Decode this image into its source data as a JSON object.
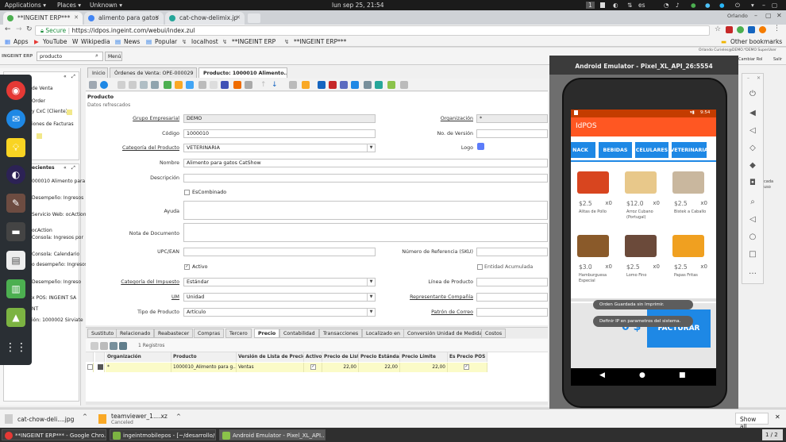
{
  "os_topbar": {
    "applications": "Applications ▾",
    "places": "Places ▾",
    "unknown": "Unknown ▾",
    "datetime": "lun sep 25, 21:54",
    "workspace": "1",
    "lang": "es"
  },
  "browser": {
    "tabs": [
      {
        "label": "**INGEINT ERP***",
        "color": "#4caf50"
      },
      {
        "label": "alimento para gatos",
        "color": "#4285f4"
      },
      {
        "label": "cat-chow-delimix.jp",
        "color": "#26a69a"
      }
    ],
    "profile": "Orlando",
    "secure_label": "Secure",
    "url": "https://idpos.ingeint.com/webui/index.zul",
    "bookmarks": [
      "Apps",
      "YouTube",
      "Wikipedia",
      "News",
      "Popular",
      "localhost",
      "**INGEINT ERP",
      "**INGEINT ERP***"
    ],
    "other_bookmarks": "Other bookmarks"
  },
  "erp": {
    "logo": "INGEINT ERP",
    "search_value": "producto",
    "menu_label": "Menú",
    "user_line": "Orlando Curieles@DEMO.*DEMO SuperUser",
    "user_links": [
      "Cambiar Rol",
      "Salir"
    ],
    "left_panel": {
      "box1": [
        "de Venta",
        "Order",
        "y CxC (Cliente)",
        "iones de Facturas"
      ],
      "recent_header": "ecientes",
      "recent": [
        "000010 Alimento para",
        "Desempeño: Ingresos",
        "Servicio Web: ocAction",
        "ocAction",
        "Consola: Ingresos por",
        "Consola: Calendario",
        "o desempeño: Ingresos",
        "Desempeño: Ingreso",
        "x POS: INGEINT SA",
        "NT",
        "ión: 1000002 Sirviate"
      ]
    },
    "main_tabs": [
      "Inicio",
      "Órdenes de Venta: OPE-000029",
      "Producto: 1000010 Alimento..."
    ],
    "form_title": "Producto",
    "form_status": "Datos refrescados",
    "fields": {
      "grupo_empresarial": {
        "label": "Grupo Empresarial",
        "value": "DEMO"
      },
      "organizacion": {
        "label": "Organización",
        "value": "*"
      },
      "codigo": {
        "label": "Código",
        "value": "1000010"
      },
      "no_version": {
        "label": "No. de Versión",
        "value": ""
      },
      "categoria_producto": {
        "label": "Categoría del Producto",
        "value": "VETERINARIA"
      },
      "logo": {
        "label": "Logo"
      },
      "nombre": {
        "label": "Nombre",
        "value": "Alimento para gatos CatShow"
      },
      "descripcion": {
        "label": "Descripción",
        "value": ""
      },
      "escombinado": {
        "label": "EsCombinado"
      },
      "ayuda": {
        "label": "Ayuda",
        "value": ""
      },
      "nota_documento": {
        "label": "Nota de Documento",
        "value": ""
      },
      "upc": {
        "label": "UPC/EAN",
        "value": ""
      },
      "no_referencia": {
        "label": "Número de Referencia (SKU)",
        "value": ""
      },
      "activo": {
        "label": "Activo"
      },
      "entidad_acumulada": {
        "label": "Entidad Acumulada"
      },
      "categoria_impuesto": {
        "label": "Categoría del Impuesto",
        "value": "Estándar"
      },
      "linea_producto": {
        "label": "Línea de Producto",
        "value": ""
      },
      "um": {
        "label": "UM",
        "value": "Unidad"
      },
      "representante": {
        "label": "Representante Compañía",
        "value": ""
      },
      "tipo_producto": {
        "label": "Tipo de Producto",
        "value": "Artículo"
      },
      "patron_correo": {
        "label": "Patrón de Correo",
        "value": ""
      }
    },
    "sub_tabs": [
      "Sustituto",
      "Relacionado",
      "Reabastecer",
      "Compras",
      "Tercero",
      "Precio",
      "Contabilidad",
      "Transacciones",
      "Localizado en",
      "Conversión Unidad de Medida",
      "Costos"
    ],
    "active_sub_tab": "Precio",
    "records_label": "1 Registros",
    "grid": {
      "headers": [
        "Organización",
        "Producto",
        "Versión de Lista de Precios",
        "Activo",
        "Precio de Lista",
        "Precio Estándar",
        "Precio Límite",
        "Es Precio POS"
      ],
      "row": {
        "organizacion": "*",
        "producto": "1000010_Alimento para g...",
        "version": "Ventas",
        "precio_lista": "22,00",
        "precio_estandar": "22,00",
        "precio_limite": "22,00"
      }
    }
  },
  "emulator": {
    "title": "Android Emulator - Pixel_XL_API_26:5554",
    "clock": "9:54",
    "app_title": "IdPOS",
    "categories": [
      "NACK",
      "BEBIDAS",
      "CELULARES",
      "VETERINARIA"
    ],
    "products": [
      {
        "price": "$2.5",
        "qty": "x0",
        "name": "Alitas de Pollo",
        "color": "#d8451f"
      },
      {
        "price": "$12.0",
        "qty": "x0",
        "name": "Arroz Cubano (Portugal)",
        "color": "#e8c88a"
      },
      {
        "price": "$2.5",
        "qty": "x0",
        "name": "Bistek a Caballo",
        "color": "#c9b79e"
      },
      {
        "price": "$3.0",
        "qty": "x0",
        "name": "Hamburguesa Especial",
        "color": "#8a5a2a"
      },
      {
        "price": "$2.5",
        "qty": "x0",
        "name": "Lomo Fino",
        "color": "#6b4a3a"
      },
      {
        "price": "$2.5",
        "qty": "x0",
        "name": "Papas Fritas",
        "color": "#f0a020"
      }
    ],
    "toast1": "Orden Guardada sin Imprimir.",
    "toast2": "Definir IP en parametros del sistema.",
    "total": "0 $",
    "facturar": "FACTURAR",
    "side_text": "cada uso"
  },
  "downloads": {
    "items": [
      {
        "name": "cat-chow-deli....jpg",
        "sub": ""
      },
      {
        "name": "teamviewer_1....xz",
        "sub": "Canceled"
      }
    ],
    "show_all": "Show all"
  },
  "taskbar": {
    "tasks": [
      "**INGEINT ERP*** - Google Chro...",
      "ingeintmobilepos - [~/desarrollo/s...",
      "Android Emulator - Pixel_XL_API..."
    ],
    "pager": "1 / 2"
  }
}
